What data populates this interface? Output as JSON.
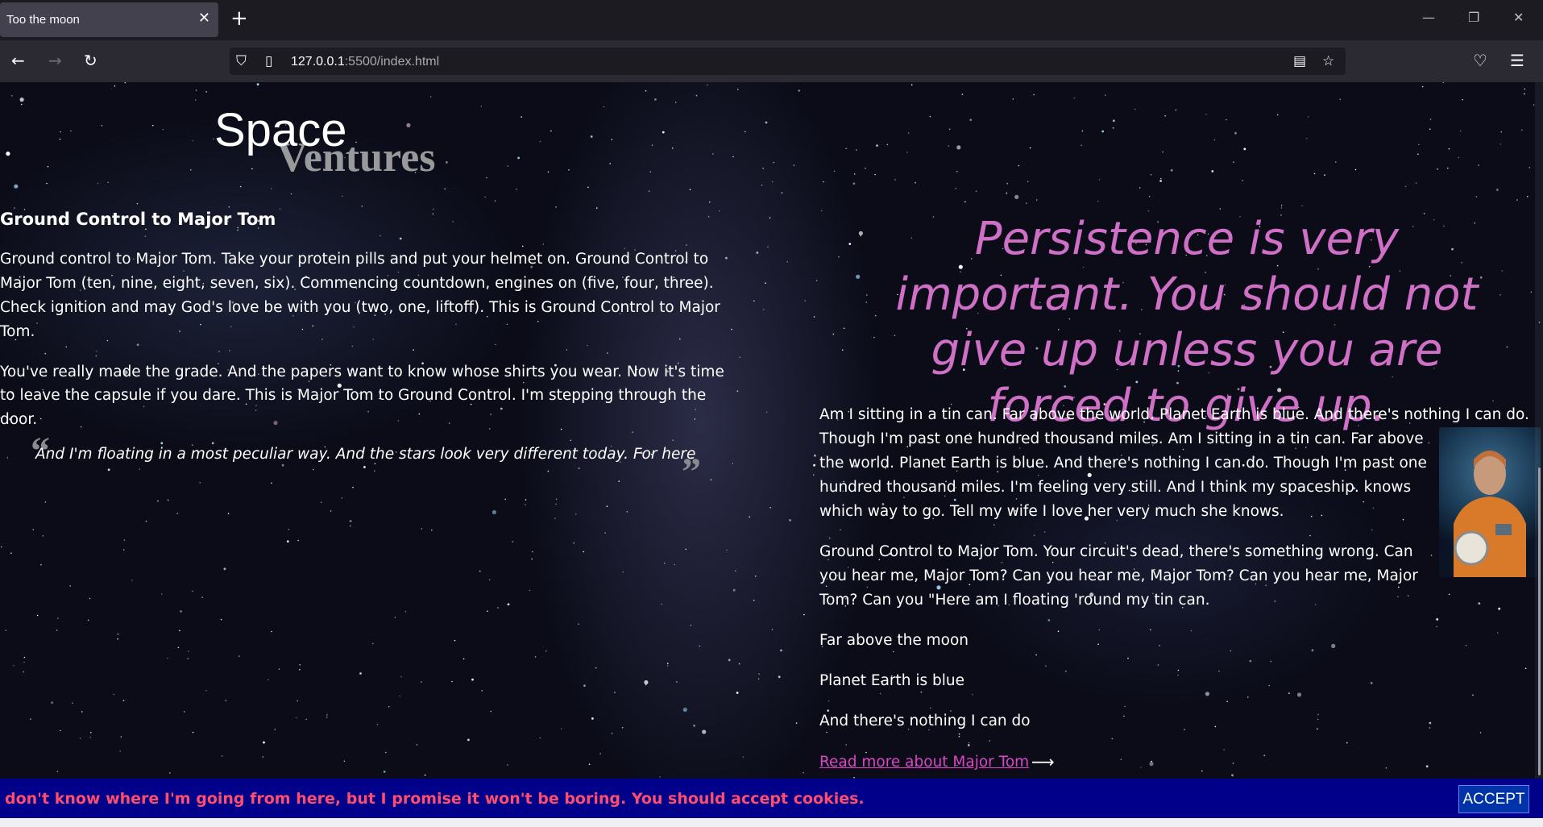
{
  "browser": {
    "tab_title": "Too the moon",
    "tab_close_icon": "close-icon",
    "new_tab_symbol": "+",
    "window_controls": [
      "—",
      "▢",
      "✕"
    ],
    "url_host": "127.0.0.1",
    "url_rest": ":5500/index.html"
  },
  "page": {
    "logo_top": "Space",
    "logo_bottom": "Ventures",
    "section_heading": "Ground Control to Major Tom",
    "left_paragraphs": [
      "Ground control to Major Tom. Take your protein pills and put your helmet on. Ground Control to Major Tom (ten, nine, eight, seven, six). Commencing countdown, engines on (five, four, three). Check ignition and may God's love be with you (two, one, liftoff). This is Ground Control to Major Tom.",
      "You've really made the grade. And the papers want to know whose shirts you wear. Now it's time to leave the capsule if you dare. This is Major Tom to Ground Control. I'm stepping through the door."
    ],
    "left_para_lines": [
      [
        "Ground control to Major Tom. Take your protein pills and put your helmet on. Ground Control to",
        "Major Tom (ten, nine, eight, seven, six). Commencing countdown, engines on (five, four, three).",
        "Check ignition and may God's love be with you (two, one, liftoff). This is Ground Control to Major",
        "Tom."
      ],
      [
        "You've really made the grade. And the papers want to know whose shirts you wear. Now it's time",
        "to leave the capsule if you dare. This is Major Tom to Ground Control. I'm stepping through the",
        "door."
      ]
    ],
    "blockquote": "And I'm floating in a most peculiar way. And the stars look very different today. For here",
    "quote_open": "“",
    "quote_close": "”",
    "big_quote": "Persistence is very important. You should not give up unless you are forced to give up.",
    "right_para1_lines": [
      "Am I sitting in a tin can. Far above the world. Planet Earth is blue. And there's nothing I can do.",
      "Though I'm past one hundred thousand miles. Am I sitting in a tin can. Far above",
      "the world. Planet Earth is blue. And there's nothing I can do. Though I'm past one",
      "hundred thousand miles. I'm feeling very still. And I think my spaceship. knows",
      "which way to go. Tell my wife I love her very much she knows."
    ],
    "right_para2_lines": [
      "Ground Control to Major Tom. Your circuit's dead, there's something wrong. Can",
      "you hear me, Major Tom? Can you hear me, Major Tom? Can you hear me, Major",
      "Tom? Can you \"Here am I floating 'round my tin can."
    ],
    "line_far": "Far above the moon",
    "line_planet": "Planet Earth is blue",
    "line_nothing": "And there's nothing I can do",
    "read_more": "Read more about Major Tom",
    "read_more_arrow": "⟶",
    "cookie_text": "don't know where I'm going from here, but I promise it won't be boring. You should accept cookies.",
    "accept_label": "ACCEPT"
  },
  "colors": {
    "quote_pink": "#cf6fc6",
    "link_magenta": "#d946c6",
    "cookie_bar": "#00008b",
    "cookie_text": "#ff4d6e"
  }
}
